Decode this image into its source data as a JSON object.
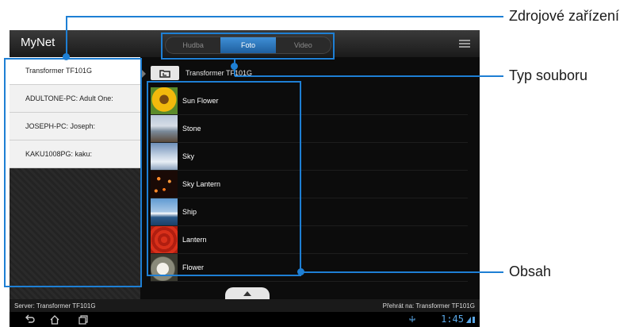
{
  "app": {
    "title": "MyNet"
  },
  "tabs": [
    {
      "label": "Hudba",
      "active": false
    },
    {
      "label": "Foto",
      "active": true
    },
    {
      "label": "Video",
      "active": false
    }
  ],
  "devices": [
    {
      "label": "Transformer TF101G",
      "selected": true
    },
    {
      "label": "ADULTONE-PC: Adult One:",
      "selected": false
    },
    {
      "label": "JOSEPH-PC: Joseph:",
      "selected": false
    },
    {
      "label": "KAKU1008PG: kaku:",
      "selected": false
    }
  ],
  "path": {
    "label": "Transformer TF101G"
  },
  "files": [
    {
      "name": "Sun Flower"
    },
    {
      "name": "Stone"
    },
    {
      "name": "Sky"
    },
    {
      "name": "Sky Lantern"
    },
    {
      "name": "Ship"
    },
    {
      "name": "Lantern"
    },
    {
      "name": "Flower"
    }
  ],
  "status": {
    "server": "Server: Transformer TF101G",
    "play_to": "Přehrát na: Transformer TF101G",
    "clock": "1:45"
  },
  "callouts": {
    "source": "Zdrojové zařízení",
    "file_type": "Typ souboru",
    "content": "Obsah"
  },
  "colors": {
    "accent": "#1e7fd4",
    "tab_active": "#2a78c0",
    "clock": "#5aa8e8"
  }
}
